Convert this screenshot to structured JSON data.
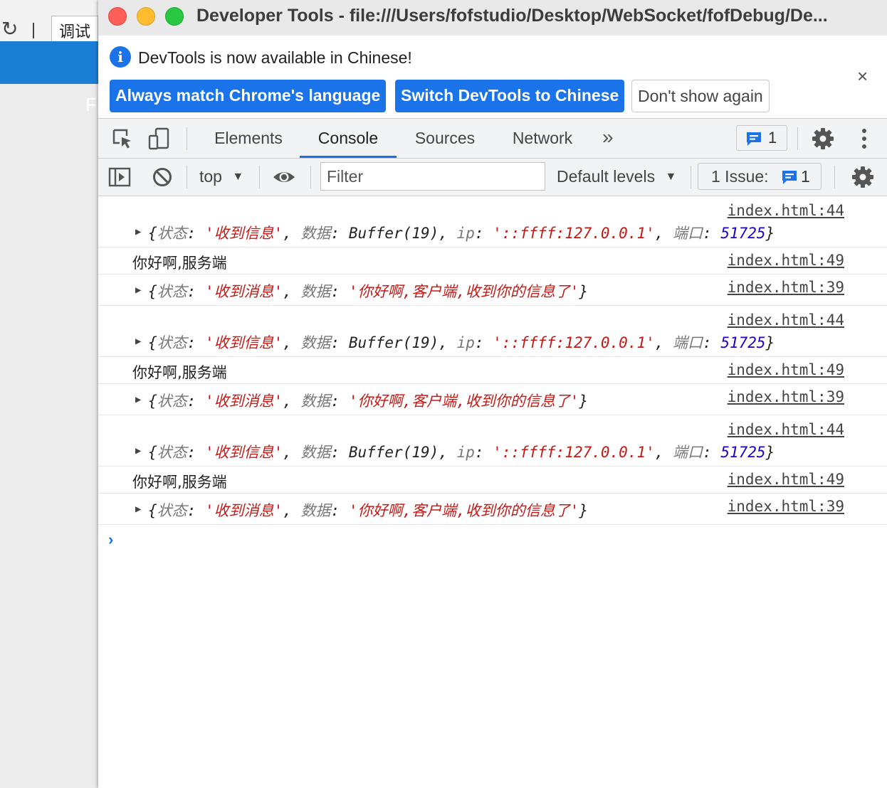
{
  "background_window": {
    "tab_label": "调试",
    "banner_letter": "F"
  },
  "window": {
    "title": "Developer Tools - file:///Users/fofstudio/Desktop/WebSocket/fofDebug/De..."
  },
  "infobar": {
    "message": "DevTools is now available in Chinese!",
    "buttons": {
      "always_match": "Always match Chrome's language",
      "switch": "Switch DevTools to Chinese",
      "dont_show": "Don't show again"
    },
    "close": "×"
  },
  "tabs": {
    "items": [
      "Elements",
      "Console",
      "Sources",
      "Network"
    ],
    "active": "Console",
    "more": "»",
    "message_count": "1"
  },
  "console_toolbar": {
    "context": "top",
    "filter_placeholder": "Filter",
    "levels": "Default levels",
    "issues_label": "1 Issue:",
    "issues_count": "1"
  },
  "console": {
    "messages": [
      {
        "type": "object",
        "source": "index.html:44",
        "key_status": "状态",
        "status": "'收到信息'",
        "key_data": "数据",
        "data": "Buffer(19)",
        "key_ip": "ip",
        "ip": "'::ffff:127.0.0.1'",
        "key_port": "端口",
        "port": "51725"
      },
      {
        "type": "text",
        "source": "index.html:49",
        "text": "你好啊,服务端"
      },
      {
        "type": "object2",
        "source": "index.html:39",
        "key_status": "状态",
        "status": "'收到消息'",
        "key_data": "数据",
        "data": "'你好啊,客户端,收到你的信息了'"
      },
      {
        "type": "object",
        "source": "index.html:44",
        "key_status": "状态",
        "status": "'收到信息'",
        "key_data": "数据",
        "data": "Buffer(19)",
        "key_ip": "ip",
        "ip": "'::ffff:127.0.0.1'",
        "key_port": "端口",
        "port": "51725"
      },
      {
        "type": "text",
        "source": "index.html:49",
        "text": "你好啊,服务端"
      },
      {
        "type": "object2",
        "source": "index.html:39",
        "key_status": "状态",
        "status": "'收到消息'",
        "key_data": "数据",
        "data": "'你好啊,客户端,收到你的信息了'"
      },
      {
        "type": "object",
        "source": "index.html:44",
        "key_status": "状态",
        "status": "'收到信息'",
        "key_data": "数据",
        "data": "Buffer(19)",
        "key_ip": "ip",
        "ip": "'::ffff:127.0.0.1'",
        "key_port": "端口",
        "port": "51725"
      },
      {
        "type": "text",
        "source": "index.html:49",
        "text": "你好啊,服务端"
      },
      {
        "type": "object2",
        "source": "index.html:39",
        "key_status": "状态",
        "status": "'收到消息'",
        "key_data": "数据",
        "data": "'你好啊,客户端,收到你的信息了'"
      }
    ],
    "prompt": "›"
  },
  "colors": {
    "accent": "#1a73e8",
    "string": "#c41a16",
    "number": "#1c00cf",
    "key": "#777777"
  }
}
